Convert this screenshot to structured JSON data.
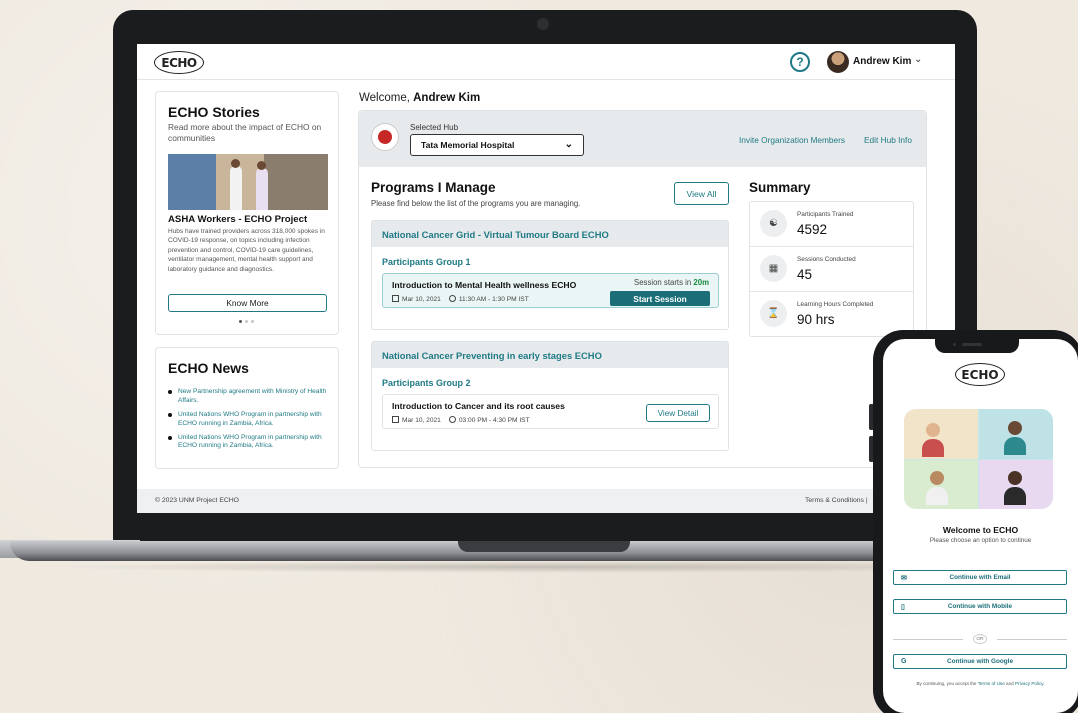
{
  "header": {
    "logo": "ECHO",
    "help": "?",
    "user_name": "Andrew Kim",
    "user_menu": "⌄"
  },
  "stories": {
    "title": "ECHO Stories",
    "subtitle": "Read more about the impact of ECHO on communities",
    "story_title": "ASHA Workers - ECHO Project",
    "story_body": "Hubs have trained providers across 318,000 spokes in COVID-19 response, on topics including infection prevention and control, COVID-19 care guidelines, ventilator management, mental health support and laboratory guidance and diagnostics.",
    "cta": "Know More"
  },
  "news": {
    "title": "ECHO News",
    "items": [
      "New Partnership agreement with Ministry of Health Affairs.",
      "United Nations WHO Program in partnership with ECHO running in Zambia, Africa.",
      "United Nations WHO Program in partnership with ECHO running in Zambia, Africa."
    ]
  },
  "welcome": {
    "prefix": "Welcome,",
    "name": "Andrew Kim"
  },
  "hub": {
    "label": "Selected Hub",
    "selected": "Tata Memorial Hospital",
    "invite_link": "Invite Organization Members",
    "edit_link": "Edit Hub Info"
  },
  "programs": {
    "title": "Programs I Manage",
    "subtitle": "Please find below the list of the programs you are managing.",
    "view_all": "View All",
    "list": [
      {
        "name": "National Cancer Grid - Virtual Tumour Board ECHO",
        "group": "Participants Group 1",
        "session_title": "Introduction to Mental Health wellness ECHO",
        "date": "Mar 10, 2021",
        "time": "11:30 AM - 1:30 PM IST",
        "starts_prefix": "Session starts in",
        "starts_value": "20m",
        "action": "Start Session"
      },
      {
        "name": "National Cancer Preventing in early stages ECHO",
        "group": "Participants Group 2",
        "session_title": "Introduction to Cancer and its root causes",
        "date": "Mar 10, 2021",
        "time": "03:00 PM - 4:30 PM IST",
        "action": "View Detail"
      }
    ]
  },
  "summary": {
    "title": "Summary",
    "stats": [
      {
        "label": "Participants Trained",
        "value": "4592",
        "icon": "people-group-icon"
      },
      {
        "label": "Sessions Conducted",
        "value": "45",
        "icon": "classroom-icon"
      },
      {
        "label": "Learning Hours Completed",
        "value": "90 hrs",
        "icon": "hourglass-icon"
      }
    ]
  },
  "footer": {
    "copyright": "© 2023 UNM Project ECHO",
    "terms": "Terms & Conditions |"
  },
  "mobile": {
    "logo": "ECHO",
    "welcome": "Welcome to ECHO",
    "subtitle": "Please choose an option to continue",
    "email_btn": "Continue with Email",
    "mobile_btn": "Continue with Mobile",
    "or": "OR",
    "google_btn": "Continue with Google",
    "legal_prefix": "By continuing, you accept the",
    "terms": "Terms of Use",
    "and": "and",
    "privacy": "Privacy Policy."
  },
  "colors": {
    "accent": "#1f7a85",
    "primary_button": "#1a6e78",
    "countdown": "#178a3c",
    "hub_bar": "#e7eaec"
  }
}
